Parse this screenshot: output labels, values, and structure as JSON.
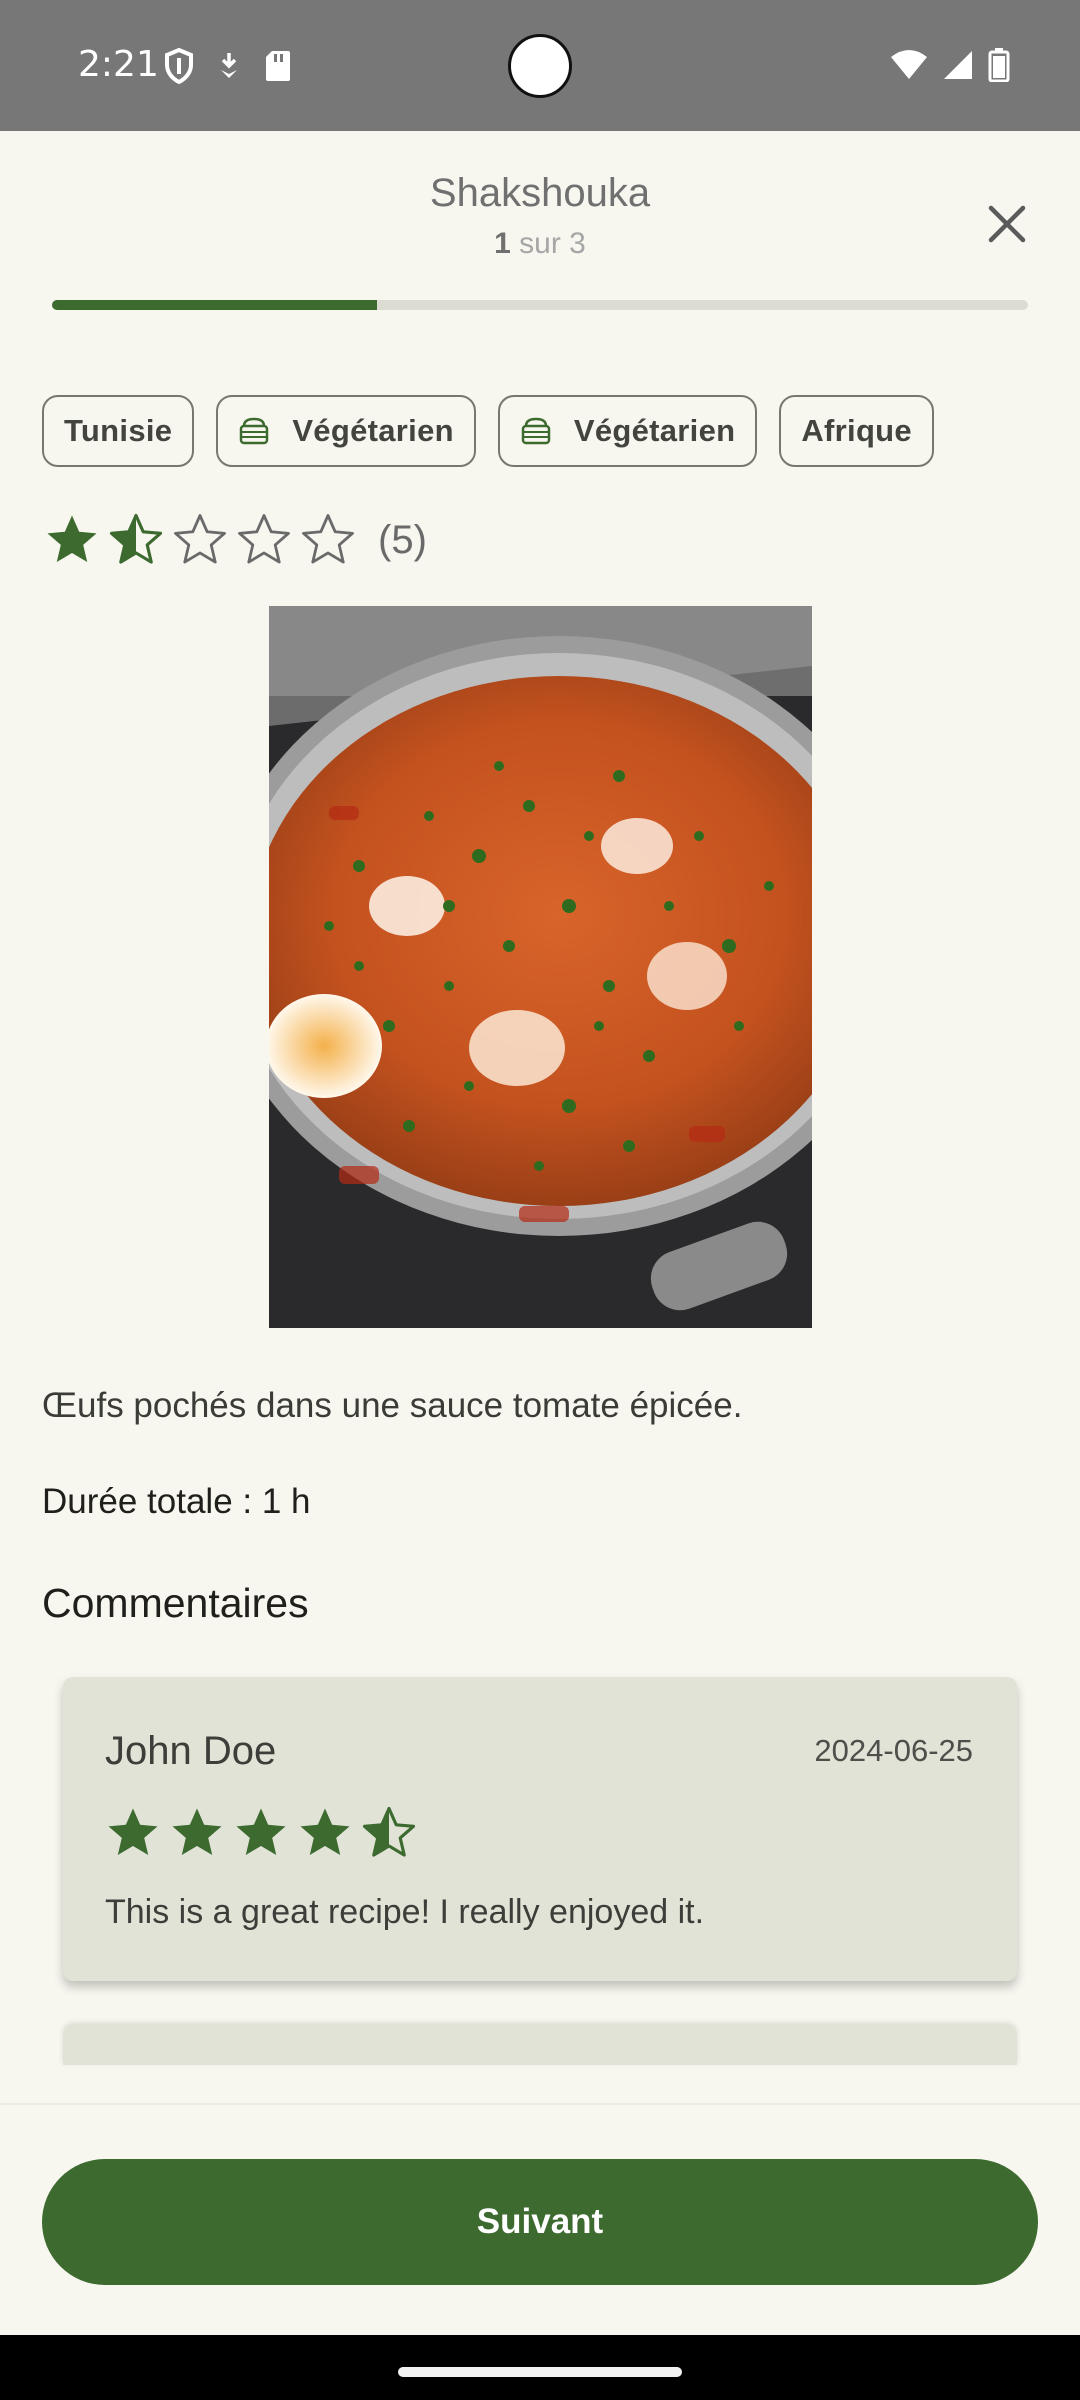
{
  "status_bar": {
    "time": "2:21",
    "left_icons": [
      "shield-icon",
      "download-icon",
      "sd-card-icon"
    ],
    "right_icons": [
      "wifi-icon",
      "signal-icon",
      "battery-icon"
    ]
  },
  "header": {
    "title": "Shakshouka",
    "step_current": "1",
    "step_suffix": "sur 3",
    "close_icon": "close-icon",
    "progress_fraction": 0.333
  },
  "chips": [
    {
      "label": "Tunisie",
      "icon": null
    },
    {
      "label": "Végétarien",
      "icon": "basket-icon"
    },
    {
      "label": "Végétarien",
      "icon": "basket-icon"
    },
    {
      "label": "Afrique",
      "icon": null
    }
  ],
  "rating": {
    "value": 1.5,
    "max": 5,
    "count_text": "(5)"
  },
  "recipe": {
    "image_alt": "Shakshouka in a pan",
    "description": "Œufs pochés dans une sauce tomate épicée.",
    "duration": "Durée totale : 1 h"
  },
  "comments": {
    "title": "Commentaires",
    "items": [
      {
        "author": "John Doe",
        "date": "2024-06-25",
        "rating": 4.5,
        "text": "This is a great recipe! I really enjoyed it."
      }
    ]
  },
  "footer": {
    "next_label": "Suivant"
  },
  "colors": {
    "accent": "#3c6a2f",
    "background": "#f7f7ef",
    "card": "#e1e3d7",
    "status_bar": "#777777"
  }
}
